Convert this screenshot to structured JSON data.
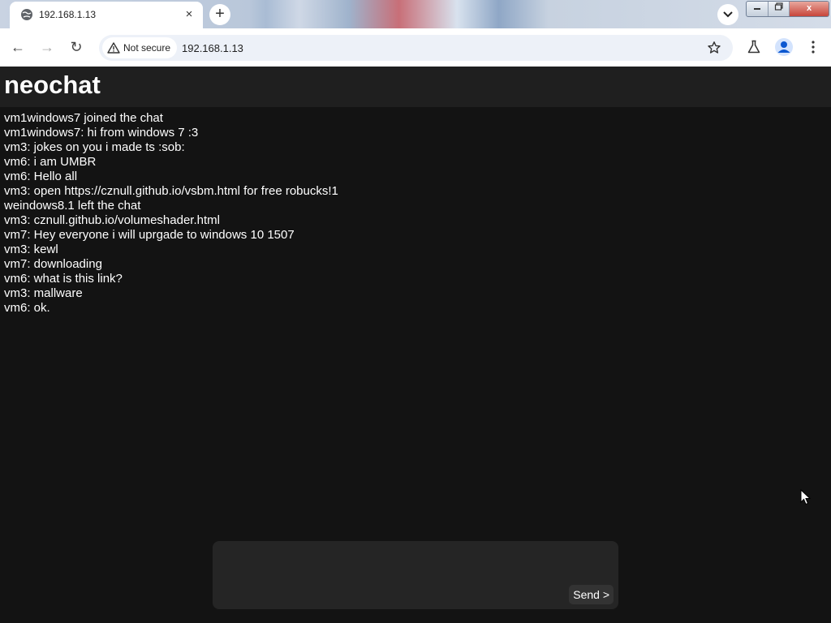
{
  "browser": {
    "tab": {
      "title": "192.168.1.13",
      "favicon": "globe-icon",
      "close": "×"
    },
    "new_tab": "+",
    "window_controls": {
      "close": "x"
    },
    "nav": {
      "back": "←",
      "forward": "→",
      "reload": "↻"
    },
    "address_bar": {
      "security_label": "Not secure",
      "url": "192.168.1.13"
    }
  },
  "app": {
    "title": "neochat",
    "messages": [
      "vm1windows7 joined the chat",
      "vm1windows7: hi from windows 7 :3",
      "vm3: jokes on you i made ts :sob:",
      "vm6: i am UMBR",
      "vm6: Hello all",
      "vm3: open https://cznull.github.io/vsbm.html for free robucks!1",
      "weindows8.1 left the chat",
      "vm3: cznull.github.io/volumeshader.html",
      "vm7: Hey everyone i will uprgade to windows 10 1507",
      "vm3: kewl",
      "vm7: downloading",
      "vm6: what is this link?",
      "vm3: mallware",
      "vm6: ok."
    ],
    "composer": {
      "input_value": "",
      "send_label": "Send >"
    }
  },
  "colors": {
    "page_background": "#131313",
    "header_background": "#1f1f1f",
    "composer_background": "#252525",
    "text": "#ffffff"
  }
}
